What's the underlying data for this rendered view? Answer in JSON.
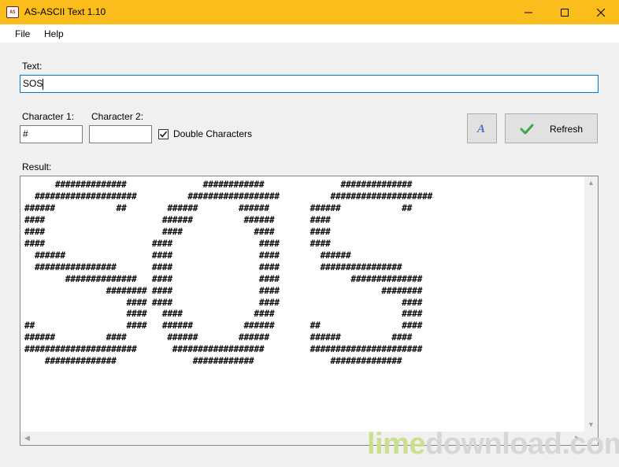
{
  "window": {
    "title": "AS-ASCII Text 1.10",
    "icon_text": "AS",
    "accent_color": "#fbbd1b",
    "buttons": [
      "minimize-icon",
      "maximize-icon",
      "close-icon"
    ]
  },
  "menu": {
    "items": [
      {
        "label": "File"
      },
      {
        "label": "Help"
      }
    ]
  },
  "form": {
    "text_label": "Text:",
    "text_value": "SOS",
    "char1_label": "Character 1:",
    "char1_value": "#",
    "char2_label": "Character 2:",
    "char2_value": "",
    "double_label": "Double Characters",
    "double_checked": true,
    "font_button_icon": "font-a-icon",
    "refresh_label": "Refresh",
    "refresh_icon": "check-icon"
  },
  "result": {
    "label": "Result:",
    "output": "      ##############               ############               ##############\n  ####################          ##################          ####################\n######            ##        ######        ######        ######            ##\n####                       ######          ######       ####\n####                       ####              ####       ####\n####                     ####                 ####      ####\n  ######                 ####                 ####        ######\n  ################       ####                 ####        ################\n        ##############   ####                 ####              ##############\n                ######## ####                 ####                    ########\n                    #### ####                 ####                        ####\n                    ####   ####              ####                         ####\n##                  ####   ######          ######       ##                ####\n######          ####        ######        ######        ######          ####\n######################       ##################         ######################\n    ##############               ############               ##############"
  },
  "watermark": {
    "part1": "lime",
    "part2": "download.com"
  }
}
